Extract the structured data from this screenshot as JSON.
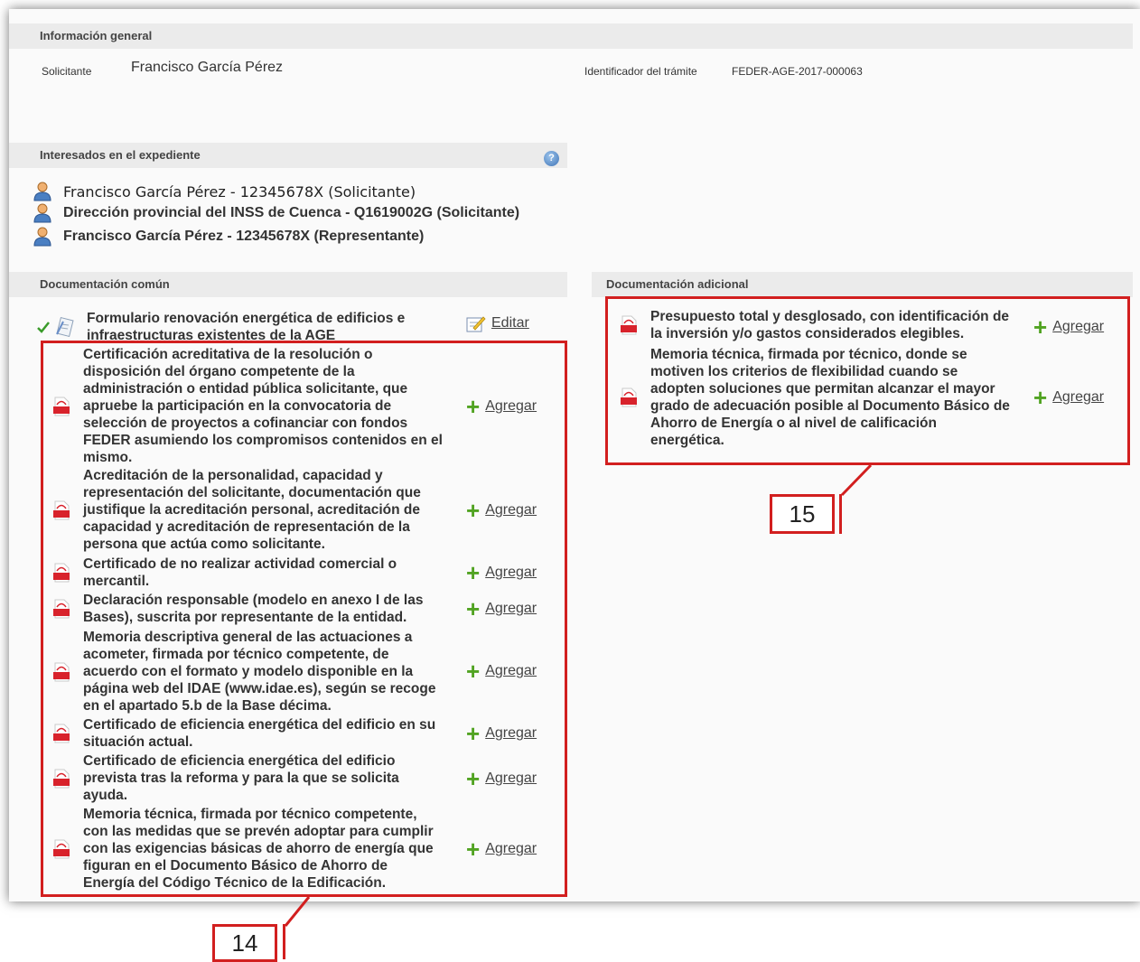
{
  "general": {
    "header": "Información general",
    "applicant_label": "Solicitante",
    "applicant_name": "Francisco García Pérez",
    "procedure_label": "Identificador del trámite",
    "procedure_id": "FEDER-AGE-2017-000063"
  },
  "interested": {
    "header": "Interesados en el expediente",
    "help_glyph": "?",
    "persons": [
      "Francisco García Pérez - 12345678X  (Solicitante)",
      "Dirección provincial del INSS de Cuenca - Q1619002G (Solicitante)",
      "Francisco García Pérez - 12345678X (Representante)"
    ]
  },
  "common_docs": {
    "header": "Documentación común",
    "form_item": {
      "lines": [
        "Formulario renovación energética de edificios e",
        "infraestructuras existentes de la AGE"
      ],
      "action": "Editar"
    },
    "items": [
      {
        "lines": [
          "Certificación acreditativa de la resolución o",
          "disposición del órgano competente de la",
          "administración o entidad pública solicitante, que",
          "apruebe la participación en la convocatoria de",
          "selección de proyectos a cofinanciar con fondos",
          "FEDER asumiendo los compromisos contenidos en el",
          "mismo."
        ],
        "action": "Agregar"
      },
      {
        "lines": [
          "Acreditación de la personalidad, capacidad y",
          "representación del solicitante, documentación que",
          "justifique la acreditación personal, acreditación de",
          "capacidad y acreditación de representación de la",
          "persona que actúa como solicitante."
        ],
        "action": "Agregar"
      },
      {
        "lines": [
          "Certificado de no realizar actividad comercial o",
          "mercantil."
        ],
        "action": "Agregar"
      },
      {
        "lines": [
          "Declaración responsable (modelo en anexo I de las",
          "Bases), suscrita por representante de la entidad."
        ],
        "action": "Agregar"
      },
      {
        "lines": [
          "Memoria descriptiva general de las actuaciones a",
          "acometer, firmada por técnico competente, de",
          "acuerdo con el formato y modelo disponible en la",
          "página web del IDAE (www.idae.es), según se recoge",
          "en el apartado 5.b de la Base décima."
        ],
        "action": "Agregar"
      },
      {
        "lines": [
          "Certificado de eficiencia energética del edificio en su",
          "situación actual."
        ],
        "action": "Agregar"
      },
      {
        "lines": [
          "Certificado de eficiencia energética del edificio",
          "prevista tras la reforma y para la que se solicita",
          "ayuda."
        ],
        "action": "Agregar"
      },
      {
        "lines": [
          "Memoria técnica, firmada por técnico competente,",
          "con las medidas que se prevén adoptar para cumplir",
          "con las exigencias básicas de ahorro de energía que",
          "figuran en el Documento Básico de Ahorro de",
          "Energía del Código Técnico de la Edificación."
        ],
        "action": "Agregar"
      }
    ]
  },
  "extra_docs": {
    "header": "Documentación adicional",
    "items": [
      {
        "lines": [
          "Presupuesto total y desglosado, con identificación de",
          "la inversión y/o gastos considerados elegibles."
        ],
        "action": "Agregar"
      },
      {
        "lines": [
          "Memoria técnica, firmada por técnico, donde se",
          "motiven los criterios de flexibilidad cuando se",
          "adopten soluciones que permitan alcanzar el mayor",
          "grado de adecuación posible al Documento Básico de",
          "Ahorro de Energía o al nivel de calificación",
          "energética."
        ],
        "action": "Agregar"
      }
    ]
  },
  "callouts": {
    "left": "14",
    "right": "15"
  },
  "colors": {
    "highlight": "#d21f1f",
    "add_icon": "#51a322",
    "pdf_icon": "#d8222b",
    "check": "#3a9b2a"
  }
}
